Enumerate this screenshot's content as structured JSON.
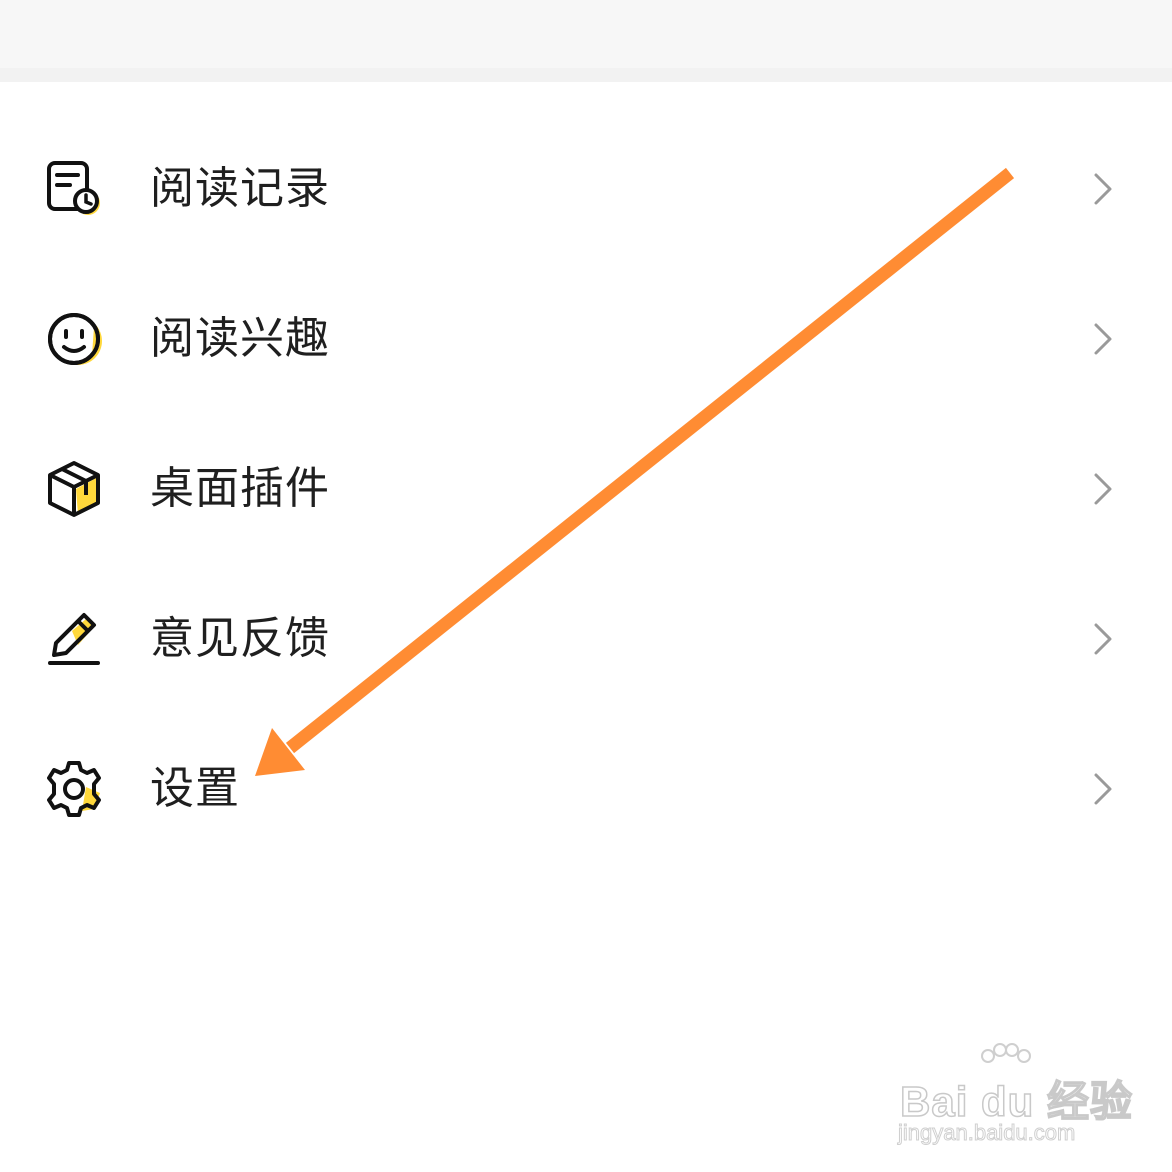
{
  "menu": {
    "items": [
      {
        "label": "阅读记录",
        "icon": "reading-history-icon"
      },
      {
        "label": "阅读兴趣",
        "icon": "smiley-icon"
      },
      {
        "label": "桌面插件",
        "icon": "cube-icon"
      },
      {
        "label": "意见反馈",
        "icon": "pencil-icon"
      },
      {
        "label": "设置",
        "icon": "gear-icon"
      }
    ],
    "chevron_icon": "chevron-right-icon"
  },
  "colors": {
    "accent_yellow": "#ffd83b",
    "annotation_arrow": "#ff8c33",
    "text": "#1f1f1f",
    "chevron": "#9a9a9a"
  },
  "watermark": {
    "brand": "Bai du 经验",
    "url": "jingyan.baidu.com"
  }
}
